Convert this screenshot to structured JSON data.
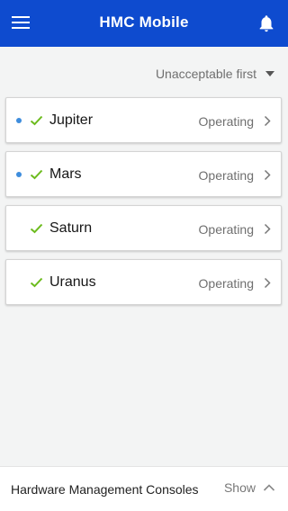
{
  "appbar": {
    "title": "HMC Mobile",
    "menu_icon": "hamburger-menu-icon",
    "bell_icon": "bell-icon",
    "color": "#0e4bcf"
  },
  "sort": {
    "label": "Unacceptable first",
    "icon": "caret-down-icon"
  },
  "systems": [
    {
      "name": "Jupiter",
      "status": "Operating",
      "unread_dot": true,
      "status_icon": "check-icon"
    },
    {
      "name": "Mars",
      "status": "Operating",
      "unread_dot": true,
      "status_icon": "check-icon"
    },
    {
      "name": "Saturn",
      "status": "Operating",
      "unread_dot": false,
      "status_icon": "check-icon"
    },
    {
      "name": "Uranus",
      "status": "Operating",
      "unread_dot": false,
      "status_icon": "check-icon"
    }
  ],
  "colors": {
    "check": "#6cbb1d",
    "dot": "#3e8ddd"
  },
  "footer": {
    "title": "Hardware Management Consoles",
    "toggle_label": "Show",
    "toggle_icon": "chevron-up-icon"
  }
}
